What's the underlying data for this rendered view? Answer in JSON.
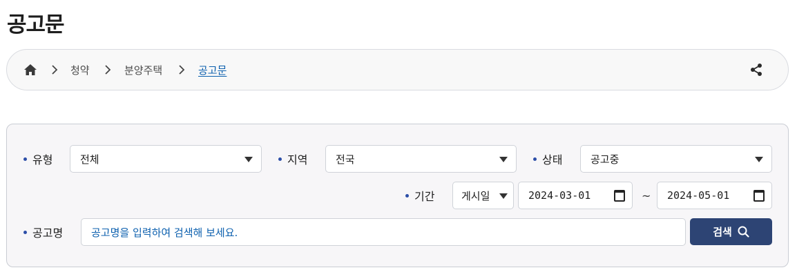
{
  "page": {
    "title": "공고문"
  },
  "breadcrumb": {
    "home_icon": "home-icon",
    "separator": "›",
    "items": [
      "청약",
      "분양주택"
    ],
    "current": "공고문",
    "share_icon": "share-icon"
  },
  "filters": {
    "type": {
      "label": "유형",
      "value": "전체"
    },
    "region": {
      "label": "지역",
      "value": "전국"
    },
    "status": {
      "label": "상태",
      "value": "공고중"
    },
    "period": {
      "label": "기간",
      "date_type": "게시일",
      "start": "2024-03-01",
      "tilde": "~",
      "end": "2024-05-01"
    },
    "name": {
      "label": "공고명",
      "placeholder": "공고명을 입력하여 검색해 보세요."
    },
    "search_button": {
      "label": "검색",
      "icon": "search-icon"
    }
  },
  "colors": {
    "accent": "#2c4ea8",
    "button": "#2d4474",
    "link": "#0b5fae"
  }
}
